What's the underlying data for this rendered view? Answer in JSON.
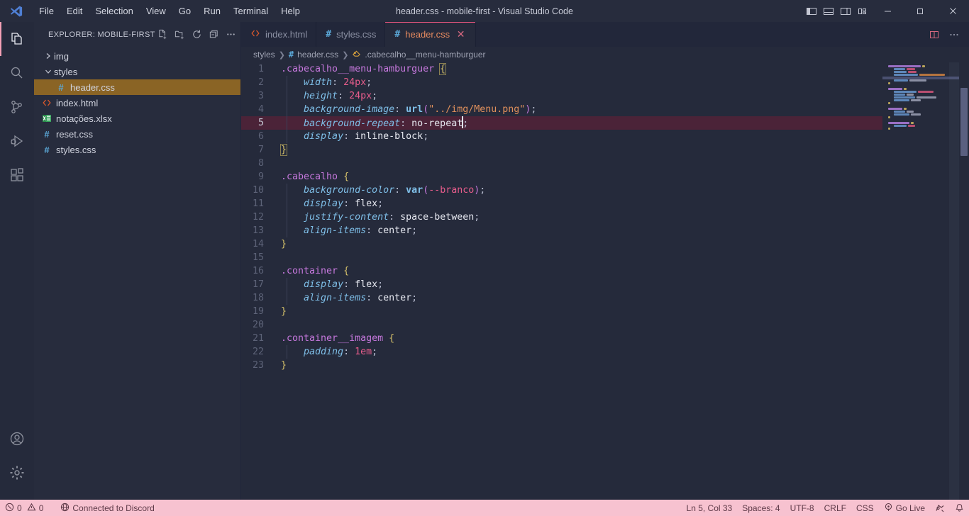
{
  "titlebar": {
    "window_title": "header.css - mobile-first - Visual Studio Code",
    "menus": [
      "File",
      "Edit",
      "Selection",
      "View",
      "Go",
      "Run",
      "Terminal",
      "Help"
    ],
    "layout_toggles": [
      {
        "name": "toggle-primary-sidebar",
        "label": "Toggle Primary Side Bar"
      },
      {
        "name": "toggle-panel",
        "label": "Toggle Panel"
      },
      {
        "name": "toggle-secondary-sidebar",
        "label": "Toggle Secondary Side Bar"
      },
      {
        "name": "customize-layout",
        "label": "Customize Layout"
      }
    ],
    "window_controls": {
      "minimize": "—",
      "maximize": "❐",
      "close": "✕"
    }
  },
  "activitybar": {
    "items": [
      {
        "name": "explorer",
        "label": "Explorer",
        "active": true
      },
      {
        "name": "search",
        "label": "Search",
        "active": false
      },
      {
        "name": "source-control",
        "label": "Source Control",
        "active": false
      },
      {
        "name": "run-debug",
        "label": "Run and Debug",
        "active": false
      },
      {
        "name": "extensions",
        "label": "Extensions",
        "active": false
      }
    ],
    "bottom_items": [
      {
        "name": "accounts",
        "label": "Accounts"
      },
      {
        "name": "settings",
        "label": "Manage"
      }
    ]
  },
  "sidebar": {
    "title": "EXPLORER: MOBILE-FIRST",
    "actions": [
      "new-file",
      "new-folder",
      "refresh-explorer",
      "collapse-folders",
      "views-and-more-actions"
    ],
    "tree": [
      {
        "label": "img",
        "type": "folder",
        "expanded": false,
        "indent": 1,
        "selected": false,
        "icon": "chevron-right"
      },
      {
        "label": "styles",
        "type": "folder",
        "expanded": true,
        "indent": 1,
        "selected": false,
        "icon": "chevron-down"
      },
      {
        "label": "header.css",
        "type": "css",
        "indent": 2,
        "selected": true,
        "icon": "hash"
      },
      {
        "label": "index.html",
        "type": "html",
        "indent": 1,
        "selected": false,
        "icon": "code"
      },
      {
        "label": "notações.xlsx",
        "type": "xlsx",
        "indent": 1,
        "selected": false,
        "icon": "excel"
      },
      {
        "label": "reset.css",
        "type": "css",
        "indent": 1,
        "selected": false,
        "icon": "hash"
      },
      {
        "label": "styles.css",
        "type": "css",
        "indent": 1,
        "selected": false,
        "icon": "hash"
      }
    ]
  },
  "tabs": [
    {
      "label": "index.html",
      "icon": "html-icon",
      "active": false,
      "closable": false
    },
    {
      "label": "styles.css",
      "icon": "css-icon",
      "active": false,
      "closable": false
    },
    {
      "label": "header.css",
      "icon": "css-icon",
      "active": true,
      "closable": true
    }
  ],
  "tab_actions": [
    "split-editor-right",
    "more-actions"
  ],
  "breadcrumb": [
    {
      "label": "styles",
      "icon": "none"
    },
    {
      "label": "header.css",
      "icon": "css-icon"
    },
    {
      "label": ".cabecalho__menu-hamburguer",
      "icon": "css-selector-icon"
    }
  ],
  "editor": {
    "language": "CSS",
    "current_line": 5,
    "total_lines": 23,
    "lines": [
      {
        "n": 1,
        "text": ".cabecalho__menu-hamburguer {"
      },
      {
        "n": 2,
        "text": "    width: 24px;"
      },
      {
        "n": 3,
        "text": "    height: 24px;"
      },
      {
        "n": 4,
        "text": "    background-image: url(\"../img/Menu.png\");"
      },
      {
        "n": 5,
        "text": "    background-repeat: no-repeat;"
      },
      {
        "n": 6,
        "text": "    display: inline-block;"
      },
      {
        "n": 7,
        "text": "}"
      },
      {
        "n": 8,
        "text": ""
      },
      {
        "n": 9,
        "text": ".cabecalho {"
      },
      {
        "n": 10,
        "text": "    background-color: var(--branco);"
      },
      {
        "n": 11,
        "text": "    display: flex;"
      },
      {
        "n": 12,
        "text": "    justify-content: space-between;"
      },
      {
        "n": 13,
        "text": "    align-items: center;"
      },
      {
        "n": 14,
        "text": "}"
      },
      {
        "n": 15,
        "text": ""
      },
      {
        "n": 16,
        "text": ".container {"
      },
      {
        "n": 17,
        "text": "    display: flex;"
      },
      {
        "n": 18,
        "text": "    align-items: center;"
      },
      {
        "n": 19,
        "text": "}"
      },
      {
        "n": 20,
        "text": ""
      },
      {
        "n": 21,
        "text": ".container__imagem {"
      },
      {
        "n": 22,
        "text": "    padding: 1em;"
      },
      {
        "n": 23,
        "text": "}"
      }
    ]
  },
  "statusbar": {
    "errors": "0",
    "warnings": "0",
    "discord": "Connected to Discord",
    "cursor_position": "Ln 5, Col 33",
    "indentation": "Spaces: 4",
    "encoding": "UTF-8",
    "eol": "CRLF",
    "language_mode": "CSS",
    "go_live": "Go Live",
    "extra_icons": [
      "remote-feedback-icon",
      "notifications-bell-icon"
    ]
  },
  "colors": {
    "accent_pink": "#e4557e",
    "statusbar_bg": "#f7c2d0",
    "editor_bg": "#252a3b",
    "sidebar_bg": "#272c3d",
    "selected_row": "#8a6425",
    "current_line": "#4b2338"
  }
}
